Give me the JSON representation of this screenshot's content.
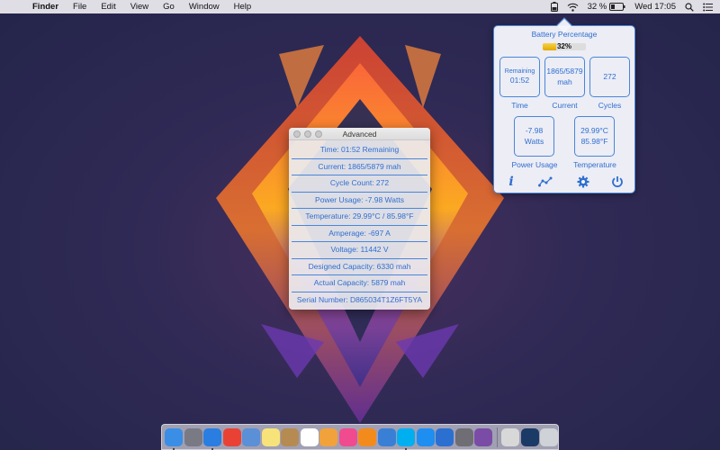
{
  "menubar": {
    "app_name": "Finder",
    "menus": [
      "File",
      "Edit",
      "View",
      "Go",
      "Window",
      "Help"
    ],
    "battery_percent_text": "32 %",
    "clock": "Wed 17:05"
  },
  "popover": {
    "title": "Battery Percentage",
    "percent": 32,
    "percent_text": "32%",
    "time": {
      "top": "Remaining",
      "value": "01:52",
      "label": "Time"
    },
    "current": {
      "line1": "1865/5879",
      "line2": "mah",
      "label": "Current"
    },
    "cycles": {
      "value": "272",
      "label": "Cycles"
    },
    "power": {
      "line1": "-7.98",
      "line2": "Watts",
      "label": "Power Usage"
    },
    "temperature": {
      "line1": "29.99°C",
      "line2": "85.98°F",
      "label": "Temperature"
    },
    "icons": [
      "info-icon",
      "graph-icon",
      "gear-icon",
      "power-icon"
    ]
  },
  "advanced": {
    "title": "Advanced",
    "rows": [
      "Time: 01:52 Remaining",
      "Current: 1865/5879 mah",
      "Cycle Count: 272",
      "Power Usage: -7.98 Watts",
      "Temperature: 29.99°C / 85.98°F",
      "Amperage: -697 A",
      "Voltage: 11442 V",
      "Designed Capacity: 6330 mah",
      "Actual Capacity: 5879 mah",
      "Serial Number: D865034T1Z6FT5YA"
    ]
  },
  "dock": {
    "apps": [
      {
        "name": "finder-icon",
        "color": "#3a8ee6",
        "running": true
      },
      {
        "name": "launchpad-icon",
        "color": "#7a7a85",
        "running": false
      },
      {
        "name": "safari-icon",
        "color": "#2a7de1",
        "running": true
      },
      {
        "name": "chrome-icon",
        "color": "#e94235",
        "running": false
      },
      {
        "name": "preview-icon",
        "color": "#5b8fd6",
        "running": false
      },
      {
        "name": "notes-icon",
        "color": "#f7e37a",
        "running": false
      },
      {
        "name": "contacts-icon",
        "color": "#b58b52",
        "running": false
      },
      {
        "name": "calendar-icon",
        "color": "#ffffff",
        "running": false
      },
      {
        "name": "photos-icon",
        "color": "#f2a23a",
        "running": false
      },
      {
        "name": "itunes-icon",
        "color": "#f04b8f",
        "running": false
      },
      {
        "name": "ibooks-icon",
        "color": "#f38b1c",
        "running": false
      },
      {
        "name": "xcode-icon",
        "color": "#3a7fd6",
        "running": false
      },
      {
        "name": "skype-icon",
        "color": "#00aff0",
        "running": true
      },
      {
        "name": "app-store-icon",
        "color": "#1f8ef1",
        "running": false
      },
      {
        "name": "quicktime-icon",
        "color": "#2b6fd1",
        "running": false
      },
      {
        "name": "system-preferences-icon",
        "color": "#6e6e74",
        "running": false
      },
      {
        "name": "instruments-icon",
        "color": "#7a4ca5",
        "running": false
      },
      {
        "name": "activity-monitor-icon",
        "color": "#d8d8d8",
        "running": false
      },
      {
        "name": "desktop-stack-icon",
        "color": "#1c3a66",
        "running": false
      },
      {
        "name": "trash-icon",
        "color": "#cfd2d6",
        "running": false
      }
    ]
  }
}
